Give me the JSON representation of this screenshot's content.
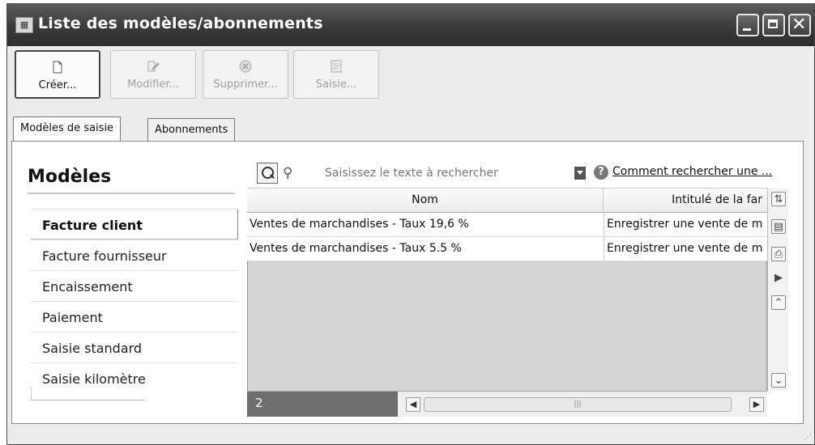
{
  "window": {
    "title": "Liste des modèles/abonnements",
    "icon": "app-icon",
    "controls": [
      "minimize",
      "maximize",
      "close"
    ]
  },
  "toolbar": {
    "buttons": [
      {
        "label": "Créer...",
        "icon": "new-document-icon",
        "enabled": true
      },
      {
        "label": "Modifier...",
        "icon": "edit-icon",
        "enabled": false
      },
      {
        "label": "Supprimer...",
        "icon": "delete-icon",
        "enabled": false
      },
      {
        "label": "Saisie...",
        "icon": "entry-form-icon",
        "enabled": false
      }
    ]
  },
  "tabs": [
    {
      "label": "Modèles de saisie",
      "selected": true
    },
    {
      "label": "Abonnements",
      "selected": false
    }
  ],
  "models": {
    "title": "Modèles",
    "items": [
      {
        "label": "Facture client",
        "selected": true
      },
      {
        "label": "Facture fournisseur",
        "selected": false
      },
      {
        "label": "Encaissement",
        "selected": false
      },
      {
        "label": "Paiement",
        "selected": false
      },
      {
        "label": "Saisie standard",
        "selected": false
      },
      {
        "label": "Saisie kilomètre",
        "selected": false
      }
    ]
  },
  "search": {
    "placeholder": "Saisissez le texte à rechercher",
    "value": "",
    "help_link": "Comment rechercher une ..."
  },
  "grid": {
    "columns": [
      "Nom",
      "Intitulé de la far"
    ],
    "rows": [
      {
        "nom": "Ventes de marchandises - Taux 19,6 %",
        "intitule": "Enregistrer une vente de m"
      },
      {
        "nom": "Ventes de marchandises - Taux 5.5 %",
        "intitule": "Enregistrer une vente de m"
      }
    ],
    "count": "2"
  }
}
